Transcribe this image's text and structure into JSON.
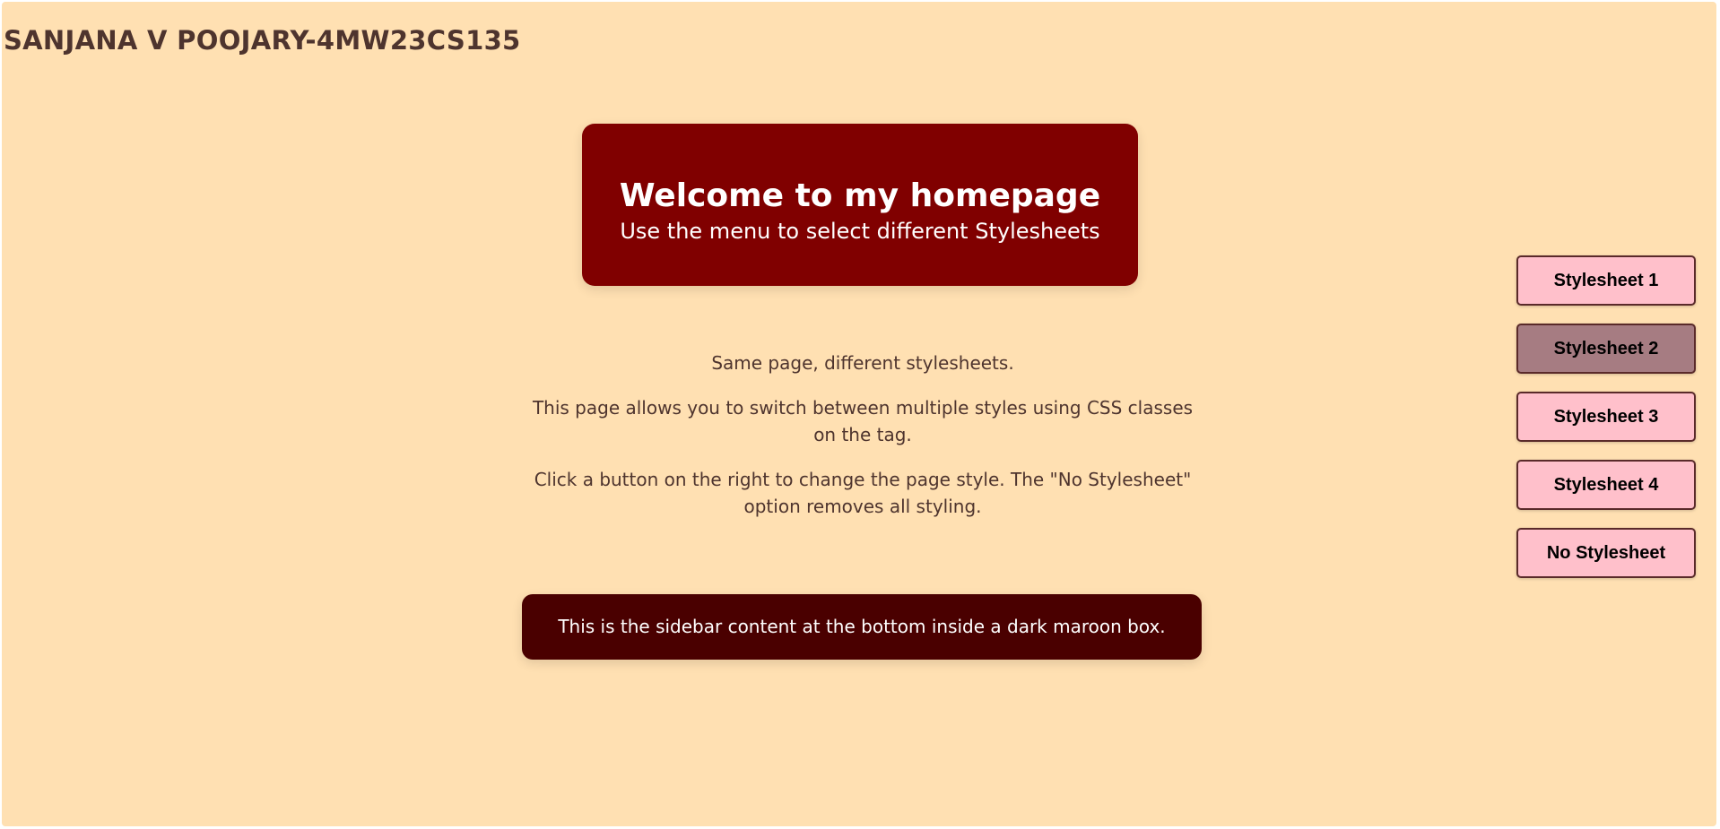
{
  "page": {
    "title": "SANJANA V POOJARY-4MW23CS135"
  },
  "hero": {
    "title": "Welcome to my homepage",
    "subtitle": "Use the menu to select different Stylesheets"
  },
  "content": {
    "paragraphs": [
      "Same page, different stylesheets.",
      "This page allows you to switch between multiple styles using CSS classes on the tag.",
      "Click a button on the right to change the page style. The \"No Stylesheet\" option removes all styling."
    ]
  },
  "sidebar": {
    "text": "This is the sidebar content at the bottom inside a dark maroon box."
  },
  "menu": {
    "buttons": [
      {
        "label": "Stylesheet 1"
      },
      {
        "label": "Stylesheet 2",
        "active": true
      },
      {
        "label": "Stylesheet 3"
      },
      {
        "label": "Stylesheet 4"
      },
      {
        "label": "No Stylesheet"
      }
    ]
  },
  "colors": {
    "background": "#ffe0b2",
    "hero_bg": "#800000",
    "sidebar_bg": "#4a0000",
    "button_bg": "#ffc0cb",
    "button_active_bg": "#a67c82",
    "text": "#4e342e"
  }
}
